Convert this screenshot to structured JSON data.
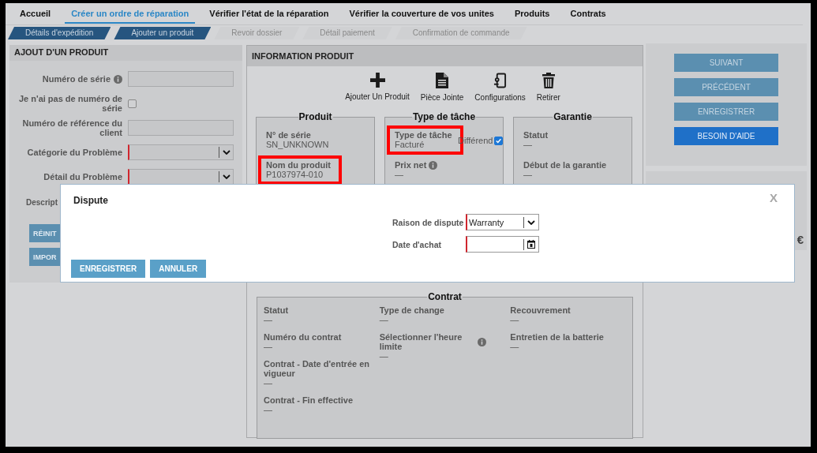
{
  "nav": [
    {
      "label": "Accueil",
      "selected": false
    },
    {
      "label": "Créer un ordre de réparation",
      "selected": true
    },
    {
      "label": "Vérifier l'état de la réparation",
      "selected": false
    },
    {
      "label": "Vérifier la couverture de vos unites",
      "selected": false
    },
    {
      "label": "Produits",
      "selected": false
    },
    {
      "label": "Contrats",
      "selected": false
    }
  ],
  "steps": [
    {
      "label": "Détails d'expédition",
      "completed": true
    },
    {
      "label": "Ajouter un produit",
      "completed": true
    },
    {
      "label": "Revoir dossier",
      "completed": false
    },
    {
      "label": "Détail paiement",
      "completed": false
    },
    {
      "label": "Confirmation de commande",
      "completed": false
    }
  ],
  "add_product": {
    "title": "AJOUT D'UN PRODUIT",
    "fields": [
      {
        "label": "Numéro de série",
        "kind": "text",
        "info": true,
        "required": false
      },
      {
        "label": "Je n'ai pas de numéro de série",
        "kind": "checkbox",
        "checked": false
      },
      {
        "label": "Numéro de référence du client",
        "kind": "text",
        "info": false,
        "required": false
      },
      {
        "label": "Catégorie du Problème",
        "kind": "select",
        "info": false,
        "required": true
      },
      {
        "label": "Détail du Problème",
        "kind": "select",
        "info": false,
        "required": true
      }
    ],
    "description_label": "Descript",
    "buttons": [
      "RÉINIT",
      "IMPOR"
    ]
  },
  "product_info": {
    "title": "INFORMATION PRODUIT",
    "actions": [
      {
        "label": "Ajouter Un Produit",
        "kind": "add"
      },
      {
        "label": "Pièce Jointe",
        "kind": "attachment"
      },
      {
        "label": "Configurations",
        "kind": "configurations"
      },
      {
        "label": "Retirer",
        "kind": "remove"
      }
    ],
    "groups": [
      {
        "title": "Produit",
        "fields": [
          {
            "label": "N° de série",
            "value": "SN_UNKNOWN",
            "highlighted": false
          },
          {
            "label": "Nom du produit",
            "value": "P1037974-010",
            "highlighted": true
          }
        ]
      },
      {
        "title": "Type de tâche",
        "fields": [
          {
            "label": "Type de tâche",
            "value": "Facturé",
            "highlighted": true,
            "checkbox": {
              "label": "Différend",
              "checked": true
            }
          },
          {
            "label": "Prix net",
            "value": "—",
            "info": true,
            "highlighted": false
          }
        ]
      },
      {
        "title": "Garantie",
        "fields": [
          {
            "label": "Statut",
            "value": "—",
            "highlighted": false
          },
          {
            "label": "Début de la garantie",
            "value": "—",
            "highlighted": false
          }
        ]
      }
    ],
    "contract": {
      "title": "Contrat",
      "columns": [
        [
          {
            "label": "Statut",
            "value": "—"
          },
          {
            "label": "Numéro du contrat",
            "value": "—"
          },
          {
            "label": "Contrat - Date d'entrée en vigueur",
            "value": "—"
          },
          {
            "label": "Contrat - Fin effective",
            "value": "—"
          }
        ],
        [
          {
            "label": "Type de change",
            "value": "—"
          },
          {
            "label": "Sélectionner l'heure limite",
            "value": "—",
            "info": true
          }
        ],
        [
          {
            "label": "Recouvrement",
            "value": "—"
          },
          {
            "label": "Entretien de la batterie",
            "value": "—"
          }
        ]
      ]
    }
  },
  "side_buttons": [
    {
      "label": "SUIVANT",
      "primary": false
    },
    {
      "label": "PRÉCÉDENT",
      "primary": false
    },
    {
      "label": "ENREGISTRER",
      "primary": false
    },
    {
      "label": "BESOIN D'AIDE",
      "primary": true
    }
  ],
  "side_currency": "€",
  "modal": {
    "title": "Dispute",
    "close": "X",
    "fields": [
      {
        "label": "Raison de dispute",
        "kind": "select",
        "value": "Warranty",
        "required": true
      },
      {
        "label": "Date d'achat",
        "kind": "date",
        "required": true
      }
    ],
    "buttons": [
      "ENREGISTRER",
      "ANNULER"
    ]
  }
}
